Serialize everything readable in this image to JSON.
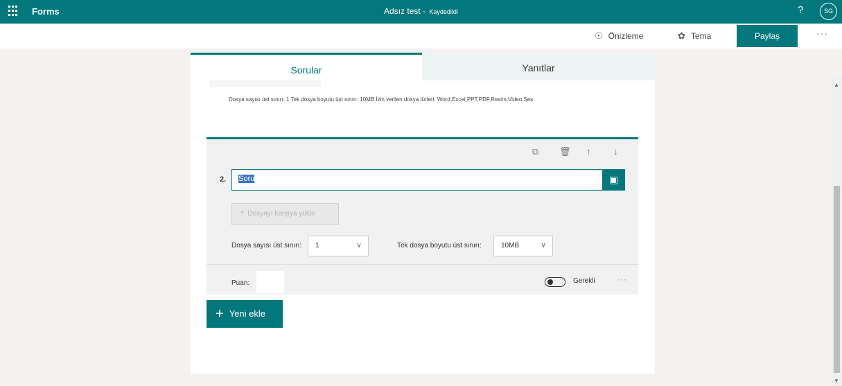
{
  "topbar": {
    "app_name": "Forms",
    "doc_title": "Adsız test",
    "separator": " - ",
    "save_status": "Kaydedildi",
    "help": "?",
    "avatar_initials": "SG"
  },
  "toolbar": {
    "preview_label": "Önizleme",
    "theme_label": "Tema",
    "share_label": "Paylaş",
    "more": "···"
  },
  "tabs": {
    "questions": "Sorular",
    "responses": "Yanıtlar"
  },
  "prev_question": {
    "info": "Dosya sayısı üst sınırı: 1   Tek dosya boyutu üst sınırı: 10MB   İzin verilen dosya türleri: Word,Excel,PPT,PDF,Resim,Video,Ses"
  },
  "question": {
    "number": "2.",
    "title_value": "Soru",
    "upload_label": "Dosyayı karşıya yükle",
    "max_files_label": "Dosya sayısı üst sınırı:",
    "max_files_value": "1",
    "max_size_label": "Tek dosya boyutu üst sınırı:",
    "max_size_value": "10MB",
    "points_label": "Puan:",
    "required_label": "Gerekli",
    "more": "···"
  },
  "add_new_label": "Yeni ekle",
  "colors": {
    "accent": "#03787c",
    "background": "#f3f2f1",
    "selection": "#3a73c5"
  },
  "icons": [
    "waffle-icon",
    "eye-icon",
    "palette-icon",
    "copy-icon",
    "trash-icon",
    "arrow-up-icon",
    "arrow-down-icon",
    "image-icon",
    "upload-icon",
    "chevron-down-icon",
    "plus-icon"
  ]
}
